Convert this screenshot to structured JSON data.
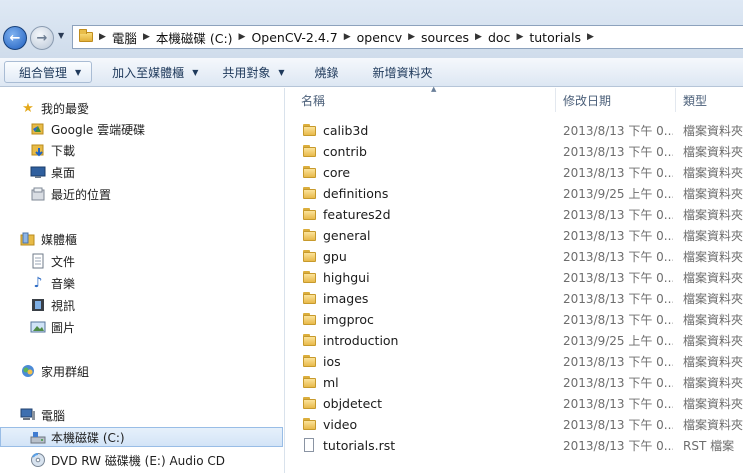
{
  "address": {
    "crumbs": [
      "電腦",
      "本機磁碟 (C:)",
      "OpenCV-2.4.7",
      "opencv",
      "sources",
      "doc",
      "tutorials"
    ]
  },
  "toolbar": {
    "organize": "組合管理",
    "add_to_library": "加入至媒體櫃",
    "share_with": "共用對象",
    "burn": "燒錄",
    "new_folder": "新增資料夾"
  },
  "nav": {
    "favorites": "我的最愛",
    "google_drive": "Google 雲端硬碟",
    "downloads": "下載",
    "desktop": "桌面",
    "recent": "最近的位置",
    "libraries": "媒體櫃",
    "documents": "文件",
    "music": "音樂",
    "videos": "視訊",
    "pictures": "圖片",
    "homegroup": "家用群組",
    "computer": "電腦",
    "local_disk": "本機磁碟 (C:)",
    "dvd": "DVD RW 磁碟機 (E:) Audio CD"
  },
  "columns": {
    "name": "名稱",
    "date": "修改日期",
    "type": "類型"
  },
  "files": [
    {
      "name": "calib3d",
      "date": "2013/8/13 下午 0...",
      "type": "檔案資料夾",
      "kind": "folder"
    },
    {
      "name": "contrib",
      "date": "2013/8/13 下午 0...",
      "type": "檔案資料夾",
      "kind": "folder"
    },
    {
      "name": "core",
      "date": "2013/8/13 下午 0...",
      "type": "檔案資料夾",
      "kind": "folder"
    },
    {
      "name": "definitions",
      "date": "2013/9/25 上午 0...",
      "type": "檔案資料夾",
      "kind": "folder"
    },
    {
      "name": "features2d",
      "date": "2013/8/13 下午 0...",
      "type": "檔案資料夾",
      "kind": "folder"
    },
    {
      "name": "general",
      "date": "2013/8/13 下午 0...",
      "type": "檔案資料夾",
      "kind": "folder"
    },
    {
      "name": "gpu",
      "date": "2013/8/13 下午 0...",
      "type": "檔案資料夾",
      "kind": "folder"
    },
    {
      "name": "highgui",
      "date": "2013/8/13 下午 0...",
      "type": "檔案資料夾",
      "kind": "folder"
    },
    {
      "name": "images",
      "date": "2013/8/13 下午 0...",
      "type": "檔案資料夾",
      "kind": "folder"
    },
    {
      "name": "imgproc",
      "date": "2013/8/13 下午 0...",
      "type": "檔案資料夾",
      "kind": "folder"
    },
    {
      "name": "introduction",
      "date": "2013/9/25 上午 0...",
      "type": "檔案資料夾",
      "kind": "folder"
    },
    {
      "name": "ios",
      "date": "2013/8/13 下午 0...",
      "type": "檔案資料夾",
      "kind": "folder"
    },
    {
      "name": "ml",
      "date": "2013/8/13 下午 0...",
      "type": "檔案資料夾",
      "kind": "folder"
    },
    {
      "name": "objdetect",
      "date": "2013/8/13 下午 0...",
      "type": "檔案資料夾",
      "kind": "folder"
    },
    {
      "name": "video",
      "date": "2013/8/13 下午 0...",
      "type": "檔案資料夾",
      "kind": "folder"
    },
    {
      "name": "tutorials.rst",
      "date": "2013/8/13 下午 0...",
      "type": "RST 檔案",
      "kind": "file"
    }
  ]
}
